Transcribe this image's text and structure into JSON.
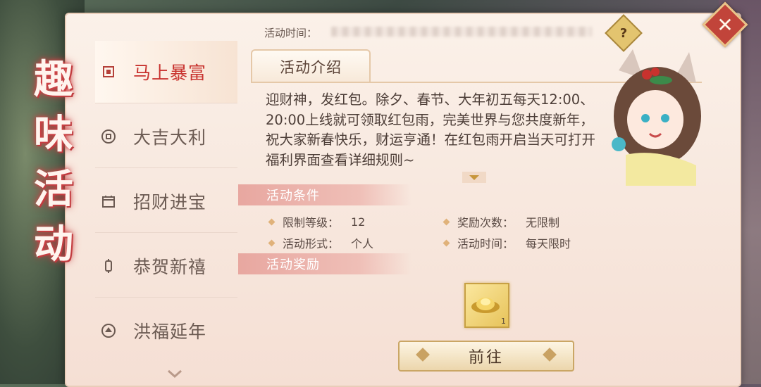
{
  "page_title_chars": [
    "趣",
    "味",
    "活",
    "动"
  ],
  "header": {
    "time_label": "活动时间："
  },
  "sidebar": {
    "items": [
      {
        "label": "马上暴富",
        "icon": "frame-icon",
        "active": true
      },
      {
        "label": "大吉大利",
        "icon": "coin-icon",
        "active": false
      },
      {
        "label": "招财进宝",
        "icon": "calendar-icon",
        "active": false
      },
      {
        "label": "恭贺新禧",
        "icon": "lantern-icon",
        "active": false
      },
      {
        "label": "洪福延年",
        "icon": "medal-icon",
        "active": false
      }
    ]
  },
  "help": {
    "label": "?"
  },
  "close": {
    "label": "✕"
  },
  "intro": {
    "tab_label": "活动介绍",
    "text": "迎财神，发红包。除夕、春节、大年初五每天12:00、20:00上线就可领取红包雨，完美世界与您共度新年，祝大家新春快乐，财运亨通！在红包雨开启当天可打开福利界面查看详细规则~"
  },
  "conditions": {
    "header": "活动条件",
    "items": [
      {
        "key": "限制等级：",
        "value": "12"
      },
      {
        "key": "奖励次数：",
        "value": "无限制"
      },
      {
        "key": "活动形式：",
        "value": "个人"
      },
      {
        "key": "活动时间：",
        "value": "每天限时"
      }
    ]
  },
  "rewards": {
    "header": "活动奖励",
    "items": [
      {
        "icon": "gold-ingot-icon",
        "qty": "1"
      }
    ]
  },
  "go_button": {
    "label": "前往"
  },
  "colors": {
    "accent": "#c8322e",
    "section": "#e8a7a0",
    "gold": "#e7c35a"
  }
}
